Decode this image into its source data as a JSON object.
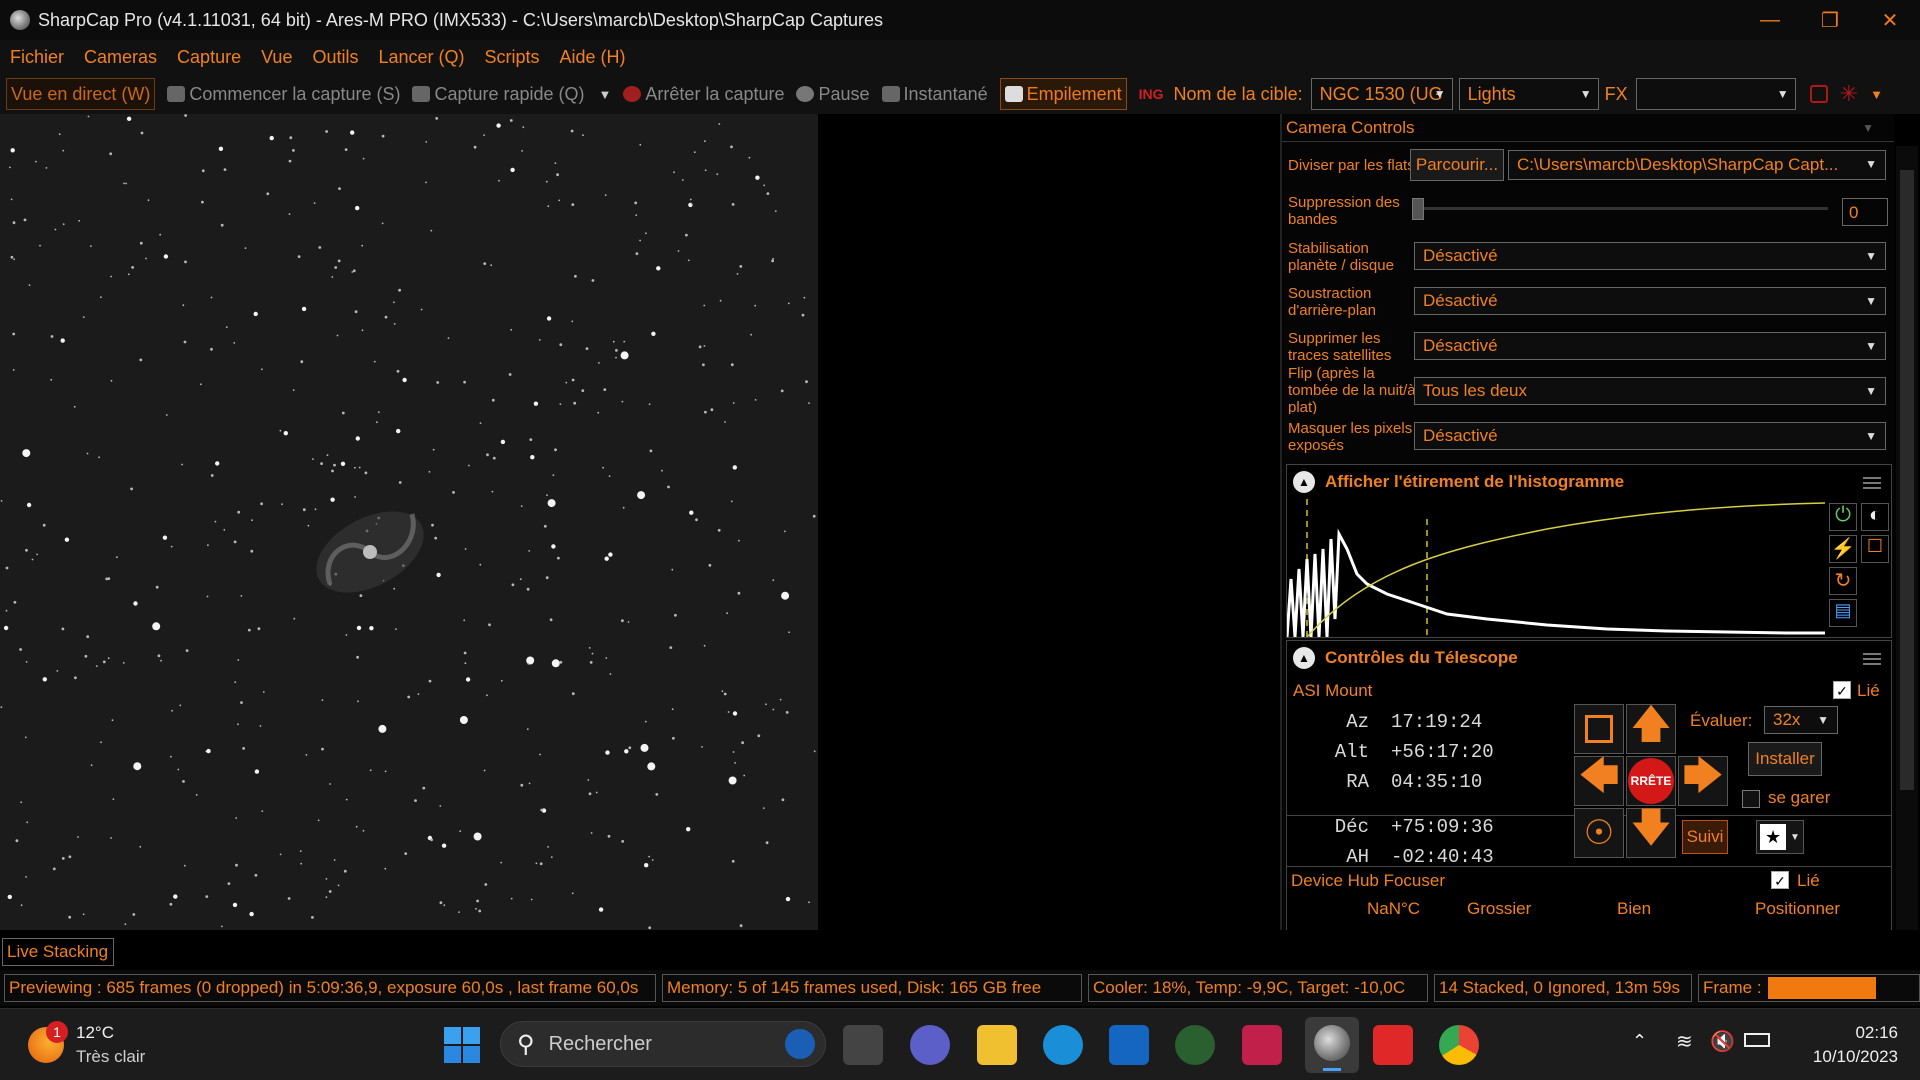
{
  "window": {
    "title": "SharpCap Pro (v4.1.11031, 64 bit) - Ares-M PRO (IMX533) - C:\\Users\\marcb\\Desktop\\SharpCap Captures"
  },
  "menu": [
    "Fichier",
    "Cameras",
    "Capture",
    "Vue",
    "Outils",
    "Lancer (Q)",
    "Scripts",
    "Aide (H)"
  ],
  "toolbar": {
    "live_view": "Vue en direct (W)",
    "start_capture": "Commencer la capture (S)",
    "quick_capture": "Capture rapide (Q)",
    "stop_capture": "Arrêter la capture",
    "pause": "Pause",
    "snapshot": "Instantané",
    "stacking": "Empilement",
    "target_label": "Nom de la cible:",
    "target_value": "NGC 1530 (UG",
    "frame_type": "Lights",
    "fx_label": "FX",
    "fx_value": ""
  },
  "camera_controls": {
    "title": "Camera Controls",
    "flats_label": "Diviser par les flats",
    "browse_button": "Parcourir...",
    "flats_path": "C:\\Users\\marcb\\Desktop\\SharpCap Capt...",
    "banding_label": "Suppression des bandes",
    "banding_value": "0",
    "stabilization_label": "Stabilisation planète / disque",
    "stabilization_value": "Désactivé",
    "background_label": "Soustraction d'arrière-plan",
    "background_value": "Désactivé",
    "satellite_label": "Supprimer les traces satellites",
    "satellite_value": "Désactivé",
    "flip_label": "Flip (après la tombée de la nuit/à plat)",
    "flip_value": "Tous les deux",
    "hotpixel_label": "Masquer les pixels exposés",
    "hotpixel_value": "Désactivé"
  },
  "histogram": {
    "title": "Afficher l'étirement de l'histogramme"
  },
  "telescope": {
    "title": "Contrôles du Télescope",
    "mount": "ASI Mount",
    "linked_label": "Lié",
    "az_label": "Az",
    "az_value": "17:19:24",
    "alt_label": "Alt",
    "alt_value": "+56:17:20",
    "ra_label": "RA",
    "ra_value": "04:35:10",
    "dec_label": "Déc",
    "dec_value": "+75:09:36",
    "ha_label": "AH",
    "ha_value": "-02:40:43",
    "stop_label": "RRÊTE",
    "rate_label": "Évaluer:",
    "rate_value": "32x",
    "install_button": "Installer",
    "park_label": "se garer",
    "tracking_button": "Suivi"
  },
  "focuser": {
    "title": "Device Hub Focuser",
    "linked_label": "Lié",
    "temp": "NaN°C",
    "coarse": "Grossier",
    "fine": "Bien",
    "position": "Positionner"
  },
  "live_stacking_tab": "Live Stacking",
  "status": {
    "preview": "Previewing : 685 frames (0 dropped) in 5:09:36,9, exposure 60,0s , last frame 60,0s",
    "memory": "Memory: 5 of 145 frames used, Disk: 165 GB free",
    "cooler": "Cooler: 18%, Temp: -9,9C, Target: -10,0C",
    "stacked": "14 Stacked, 0 Ignored, 13m 59s",
    "frame_label": "Frame :"
  },
  "taskbar": {
    "weather_temp": "12°C",
    "weather_desc": "Très clair",
    "weather_badge": "1",
    "search_placeholder": "Rechercher",
    "time": "02:16",
    "date": "10/10/2023"
  },
  "colors": {
    "accent": "#f08020",
    "background": "#000000"
  }
}
